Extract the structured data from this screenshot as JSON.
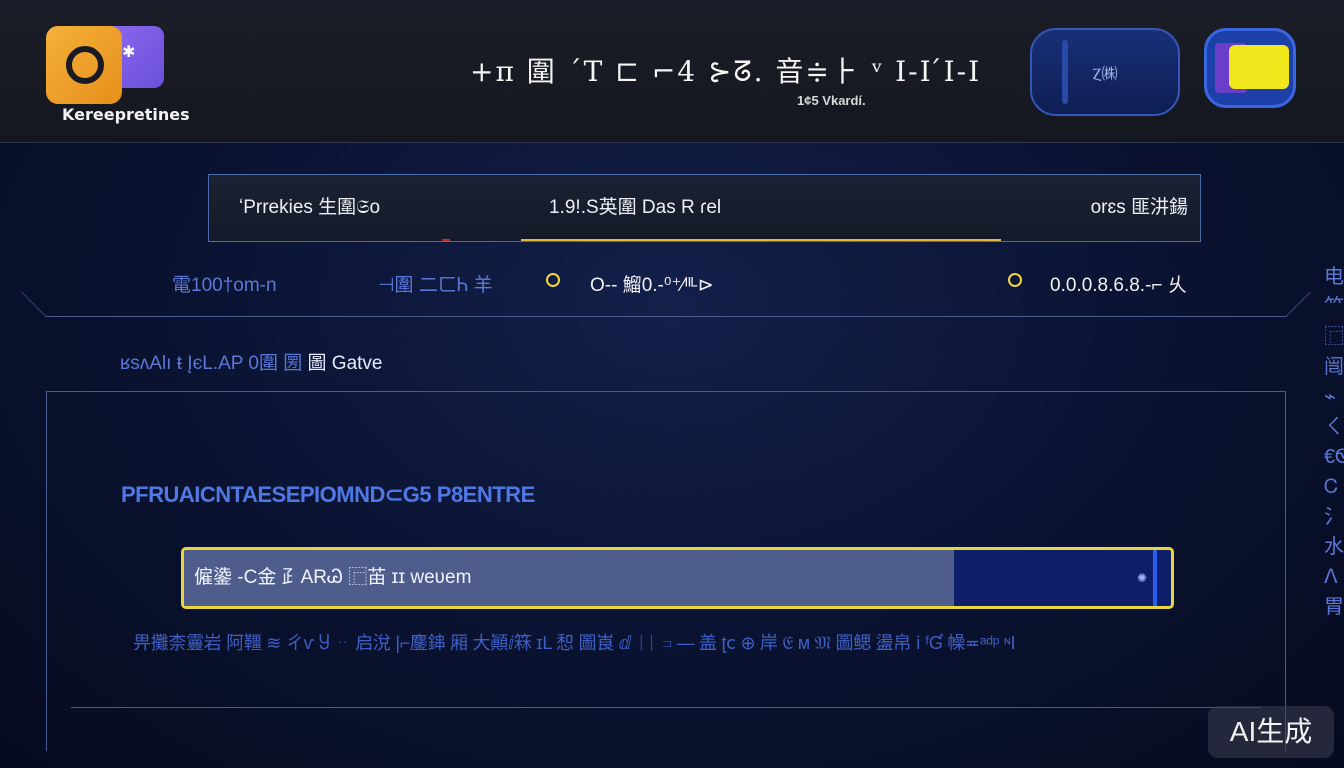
{
  "header": {
    "logo_text": "Kereepretines",
    "title": "+ᴨ 圍 ˊT ⊏ ⌐4 ⊱ᘔ.  ⾳≑⺊ ᵛ I-I ́I-I",
    "subtitle": "1¢5 Vkardí.",
    "btn_left_label": "Ⲍ㈱",
    "btn_right_label": ""
  },
  "tabs": [
    {
      "label": "ʻPrrekies 生圍𝔖o"
    },
    {
      "label": "1.9!.S英圍 Das R ɾel"
    },
    {
      "label": "orɛs 匪汫鍚"
    }
  ],
  "stats": [
    {
      "label": "電100†om-n"
    },
    {
      "label": "⊣圍 ⼆ㄈᏂ ⽺"
    },
    {
      "label": "O-- 鰡0.-⁰⁺⁄ᴵᴵᴸ⊳"
    },
    {
      "label": "0.0.0.8.6.8.-⌐ 乆"
    }
  ],
  "section_label": {
    "prefix": "ʁsʌAlı ŧ ĮєL.AP 0圍 圐",
    "highlight": "圖 Gatve"
  },
  "panel": {
    "title": "PFRUAICNTAESEPIOMND⊂G5 P8ENTRE",
    "progress": {
      "label": "僱鍌 -C⾦ ⺪ARᏊ ⿸苖 ɪɪ weʋem",
      "value_glyph": "✺",
      "fraction": 0.78
    },
    "description": "畀攤柰霻岩 阿韁 ≋ ㄔⱱ Ⴘ ᆢ 启涗 |⌐鏖鋛 厢 大顚ⅈ箖 ɪL 惒 圖崀 ⅆ ᛁᛁ ⊐ — 盖 ʈⅽ ⊕ 岸 𝔈 ᴍ 𝔐 圖鳃 盪帛 ⅰ ᶠƓ 幧≖ᵃᵈᵖ ᶰI"
  },
  "side_text": "电⺮⿸闿⌁ㄑ€ᏫᏟ⺡⽔ᐱ胃",
  "watermark": "AI生成",
  "colors": {
    "accent_yellow": "#e8d63a",
    "accent_blue": "#4f78e4",
    "bg_dark": "#0a1230"
  }
}
